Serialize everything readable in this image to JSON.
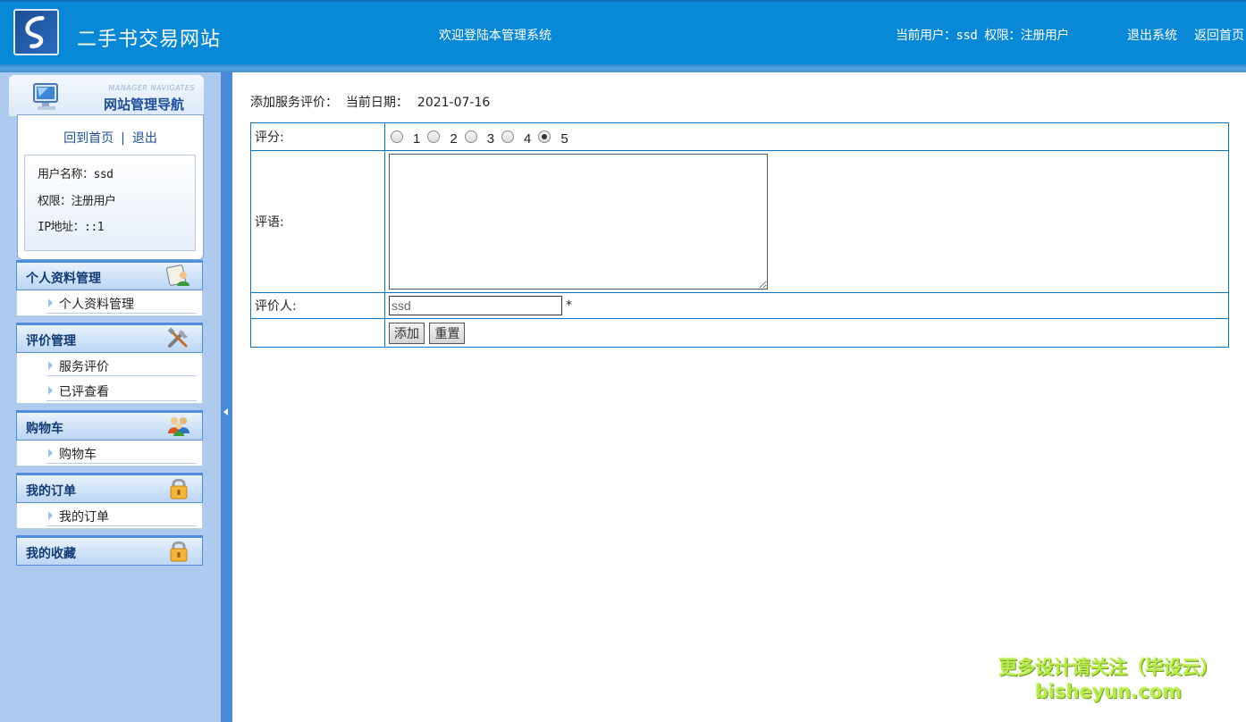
{
  "header": {
    "site_title": "二手书交易网站",
    "welcome": "欢迎登陆本管理系统",
    "current_user": "当前用户：ssd 权限：注册用户",
    "logout": "退出系统",
    "home": "返回首页"
  },
  "sidebar": {
    "nav_subtitle": "MANAGER NAVIGATES",
    "nav_title": "网站管理导航",
    "home_link": "回到首页",
    "separator": "|",
    "exit_link": "退出",
    "user_name": "用户名称：ssd",
    "permission": "权限：注册用户",
    "ip": "IP地址：::1",
    "menus": [
      {
        "title": "个人资料管理",
        "icon": "profile-icon",
        "items": [
          "个人资料管理"
        ]
      },
      {
        "title": "评价管理",
        "icon": "tools-icon",
        "items": [
          "服务评价",
          "已评查看"
        ]
      },
      {
        "title": "购物车",
        "icon": "users-icon",
        "items": [
          "购物车"
        ]
      },
      {
        "title": "我的订单",
        "icon": "lock-icon",
        "items": [
          "我的订单"
        ]
      },
      {
        "title": "我的收藏",
        "icon": "lock-icon",
        "items": []
      }
    ]
  },
  "main": {
    "breadcrumb": "添加服务评价：  当前日期：",
    "date": "2021-07-16",
    "score_label": "评分:",
    "score_options": [
      "1",
      "2",
      "3",
      "4",
      "5"
    ],
    "score_selected": "5",
    "comment_label": "评语:",
    "comment_value": "",
    "reviewer_label": "评价人:",
    "reviewer_value": "ssd",
    "required_mark": "*",
    "add_button": "添加",
    "reset_button": "重置"
  },
  "watermark": {
    "line1": "更多设计请关注（毕设云）",
    "line2": "bisheyun.com"
  }
}
